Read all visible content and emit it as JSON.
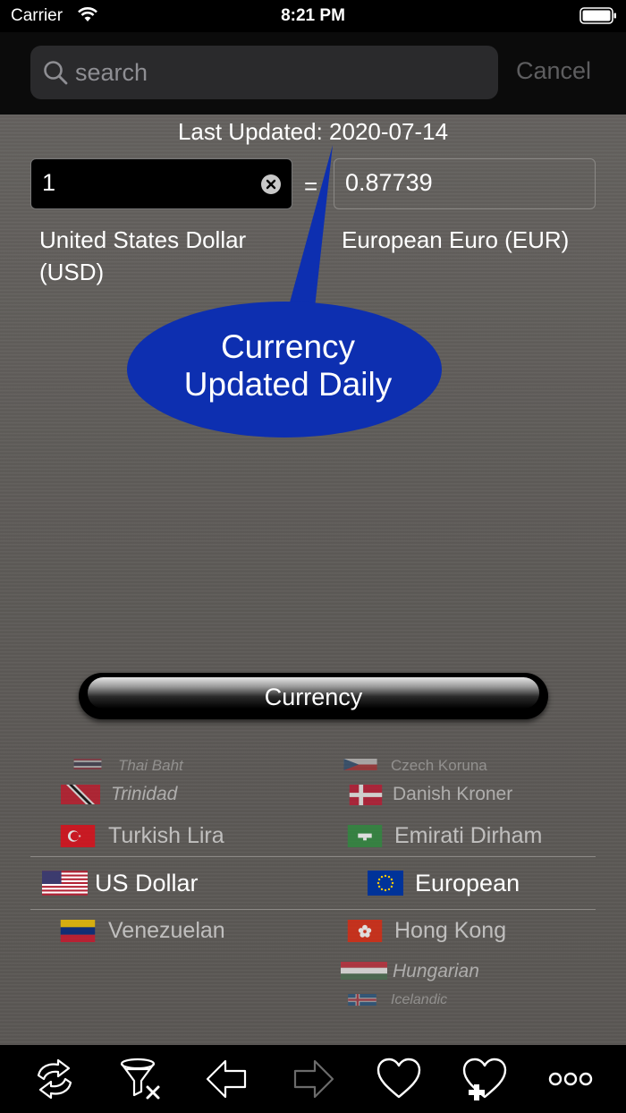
{
  "status_bar": {
    "carrier": "Carrier",
    "time": "8:21 PM"
  },
  "search": {
    "placeholder": "search",
    "value": "",
    "cancel_label": "Cancel"
  },
  "last_updated": "Last Updated: 2020-07-14",
  "converter": {
    "from_value": "1",
    "equals": "=",
    "to_value": "0.87739",
    "from_name_line1": "United States Dollar",
    "from_name_line2": "(USD)",
    "to_name": "European Euro (EUR)"
  },
  "callout": {
    "line1": "Currency",
    "line2": "Updated Daily"
  },
  "currency_button": "Currency",
  "picker": {
    "left": [
      "Thai Baht",
      "Trinidad",
      "Turkish Lira",
      "US Dollar",
      "Venezuelan"
    ],
    "right": [
      "Czech Koruna",
      "Danish Kroner",
      "Emirati Dirham",
      "European",
      "Hong Kong",
      "Hungarian",
      "Icelandic"
    ]
  },
  "tab_bar": {
    "items": [
      "refresh-icon",
      "clear-filter-icon",
      "back-arrow-icon",
      "forward-arrow-icon",
      "favorite-icon",
      "add-favorite-icon",
      "more-icon"
    ]
  }
}
